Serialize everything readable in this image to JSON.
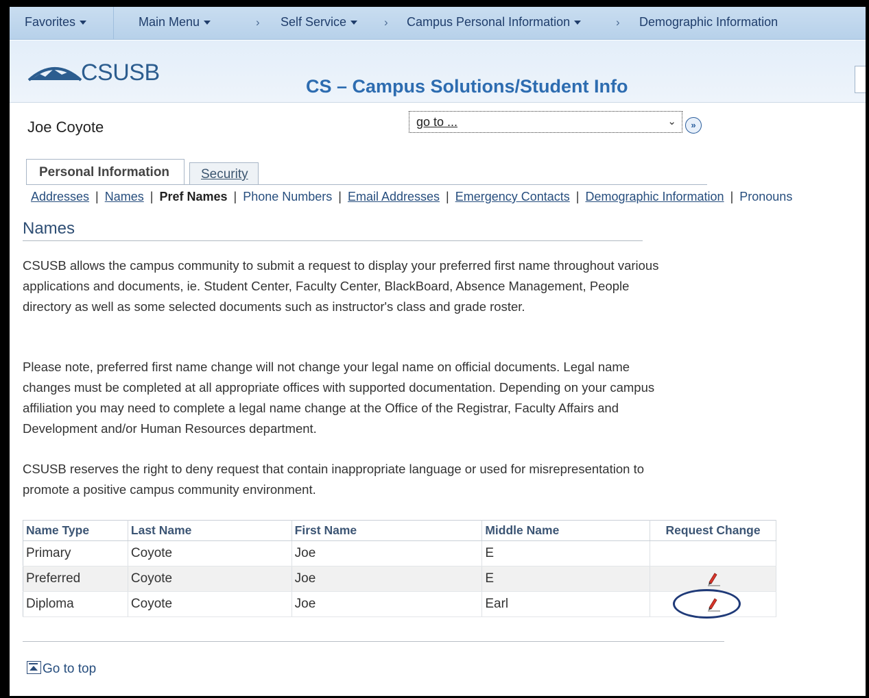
{
  "nav": {
    "favorites": "Favorites",
    "main_menu": "Main Menu",
    "self_service": "Self Service",
    "campus_personal_info": "Campus Personal Information",
    "demographic_info": "Demographic Information"
  },
  "header": {
    "logo_text": "CSUSB",
    "app_title": "CS – Campus Solutions/Student Info"
  },
  "user_name": "Joe Coyote",
  "goto": {
    "value": "go to ..."
  },
  "tabs": [
    {
      "label": "Personal Information",
      "active": true
    },
    {
      "label": "Security",
      "active": false
    }
  ],
  "sublinks": {
    "addresses": "Addresses",
    "names": "Names",
    "pref_names": "Pref Names",
    "phone_numbers": "Phone Numbers",
    "email_addresses": "Email Addresses",
    "emergency_contacts": "Emergency Contacts",
    "demographic_information": "Demographic Information",
    "pronouns": "Pronouns",
    "separator": "|"
  },
  "page_title": "Names",
  "paragraphs": [
    "CSUSB allows the campus community to submit a request to display your preferred first name throughout various applications and documents, ie. Student Center, Faculty Center, BlackBoard, Absence Management, People directory as well as some selected documents such as instructor's class and grade roster.",
    "Please note, preferred first name change will not change your legal name on official documents. Legal name changes must be completed at all appropriate offices with supported documentation. Depending on your campus affiliation you may need to complete a legal name change at the Office of the Registrar, Faculty Affairs and Development and/or Human Resources department.",
    "CSUSB reserves the right to deny request that contain inappropriate language or used for misrepresentation to promote a positive campus community environment."
  ],
  "table": {
    "headers": [
      "Name Type",
      "Last Name",
      "First Name",
      "Middle Name",
      "Request Change"
    ],
    "rows": [
      {
        "type": "Primary",
        "last": "Coyote",
        "first": "Joe",
        "middle": "E",
        "editable": false
      },
      {
        "type": "Preferred",
        "last": "Coyote",
        "first": "Joe",
        "middle": "E",
        "editable": true
      },
      {
        "type": "Diploma",
        "last": "Coyote",
        "first": "Joe",
        "middle": "Earl",
        "editable": true
      }
    ]
  },
  "goto_top": "Go to top",
  "colors": {
    "nav_bg": "#b7d1ea",
    "title_blue": "#2d6cb0",
    "link_blue": "#274e7e",
    "highlight_ring": "#1f3a78"
  }
}
